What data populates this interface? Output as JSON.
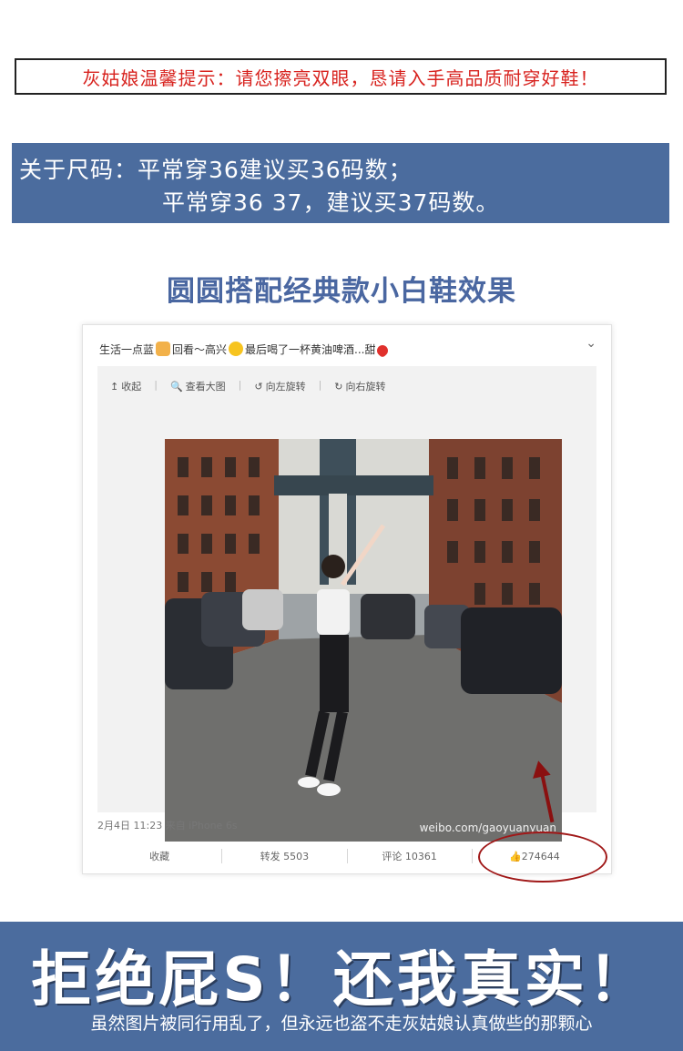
{
  "notice": "灰姑娘温馨提示：请您擦亮双眼，恳请入手高品质耐穿好鞋！",
  "size_tip": {
    "line1": "关于尺码：平常穿36建议买36码数；",
    "line2": "平常穿36 37，建议买37码数。"
  },
  "effect_title": "圆圆搭配经典款小白鞋效果",
  "weibo": {
    "post_text_a": "生活一点蓝",
    "post_text_b": "回看～高兴",
    "post_text_c": "最后喝了一杯黄油啤酒...甜",
    "chevron": "⌄",
    "tools": [
      {
        "icon": "↥",
        "label": "收起"
      },
      {
        "icon": "🔍",
        "label": "查看大图"
      },
      {
        "icon": "↺",
        "label": "向左旋转"
      },
      {
        "icon": "↻",
        "label": "向右旋转"
      }
    ],
    "watermark": "weibo.com/gaoyuanyuan",
    "meta": "2月4日 11:23 来自 iPhone 6s",
    "actions": {
      "favorite": "收藏",
      "repost": "转发 5503",
      "comment": "评论 10361",
      "like": "274644"
    }
  },
  "slogan": "拒绝屁S！还我真实！",
  "slogan_sub": "虽然图片被同行用乱了，但永远也盗不走灰姑娘认真做些的那颗心",
  "colors": {
    "notice_red": "#d8231f",
    "panel_blue": "#4b6c9e",
    "title_blue": "#4a67a1",
    "circle_red": "#a01818"
  }
}
